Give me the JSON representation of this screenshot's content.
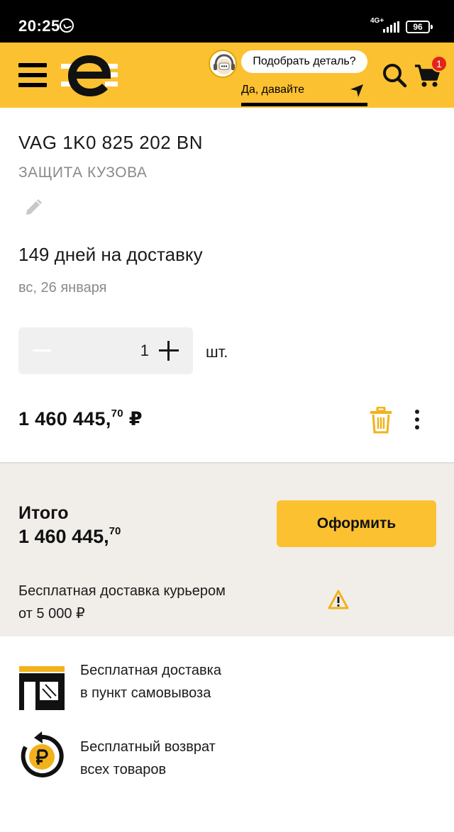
{
  "status_bar": {
    "time": "20:25",
    "network": "4G+",
    "battery": "96"
  },
  "header": {
    "bot_question": "Подобрать деталь?",
    "bot_reply": "Да, давайте",
    "cart_count": "1",
    "brand_color": "#fcc131",
    "icons": [
      "menu-icon",
      "logo-e",
      "bot-avatar",
      "send-icon",
      "search-icon",
      "cart-icon"
    ]
  },
  "product": {
    "code": "VAG 1K0 825 202 BN",
    "category": "ЗАЩИТА КУЗОВА",
    "delivery_days": "149 дней на доставку",
    "delivery_date": "вс, 26 января",
    "quantity": "1",
    "unit": "шт.",
    "price_main": "1 460 445,",
    "price_cents": "70",
    "price_currency": " ₽"
  },
  "total": {
    "label": "Итого",
    "value_main": "1 460 445,",
    "value_cents": "70",
    "checkout_label": "Оформить",
    "courier_line1": "Бесплатная доставка курьером",
    "courier_line2": "от 5 000 ₽"
  },
  "features": [
    {
      "line1": "Бесплатная доставка",
      "line2": "в пункт самовывоза",
      "icon": "pickup-point-icon"
    },
    {
      "line1": "Бесплатный возврат",
      "line2": "всех товаров",
      "icon": "ruble-return-icon"
    }
  ]
}
